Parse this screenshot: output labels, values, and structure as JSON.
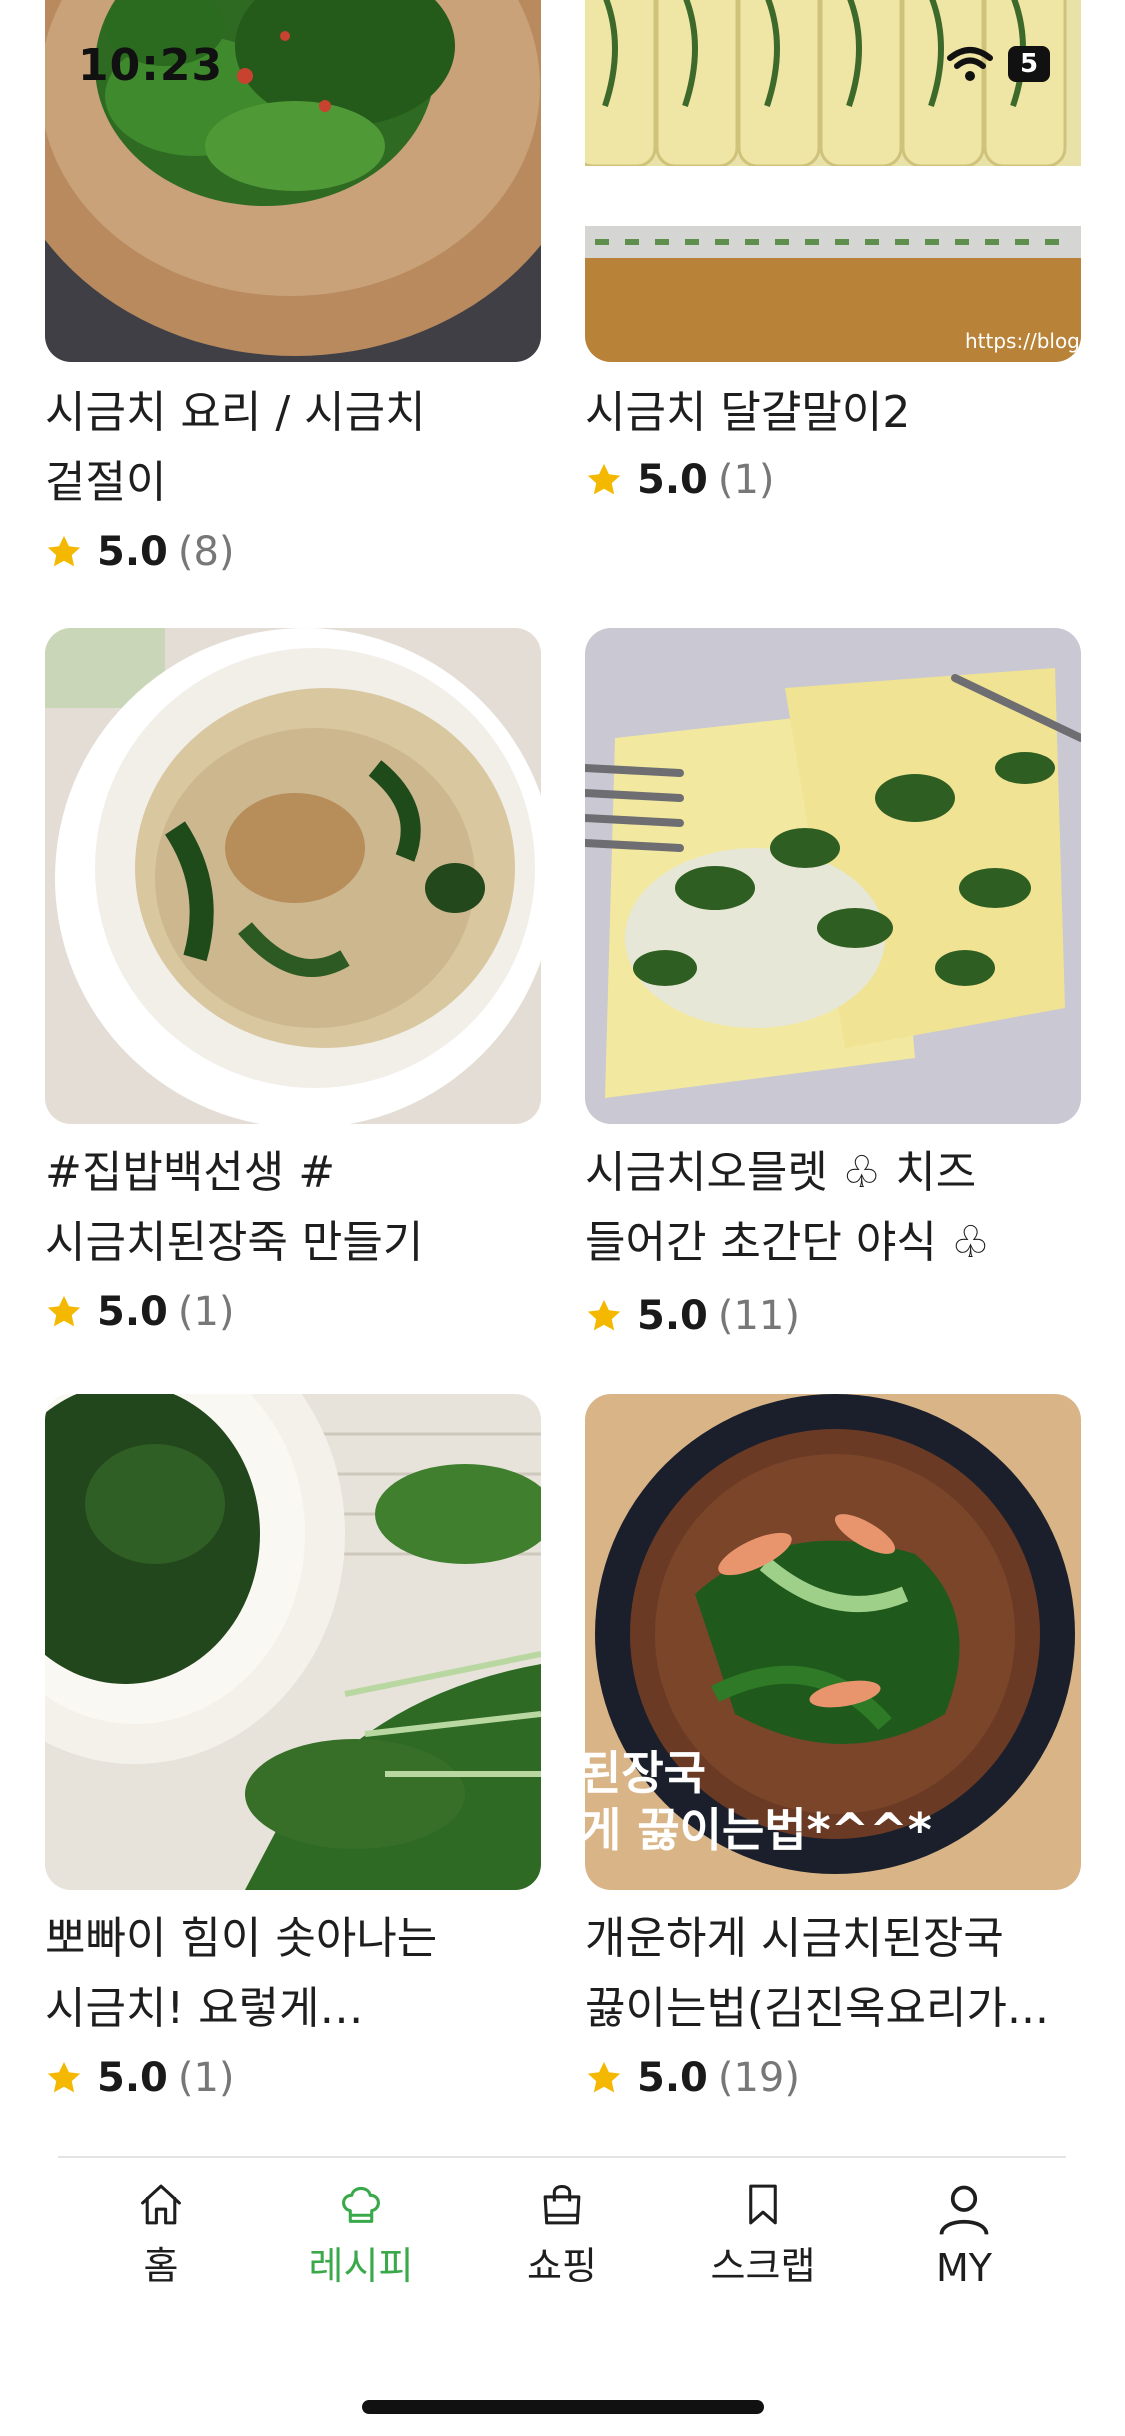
{
  "status_bar": {
    "time": "10:23",
    "battery": "5"
  },
  "recipes": [
    {
      "title": "시금치 요리 / 시금치 겉절이",
      "score": "5.0",
      "count": "(8)"
    },
    {
      "title": "시금치 달걀말이2",
      "score": "5.0",
      "count": "(1)"
    },
    {
      "title": "#집밥백선생 #시금치된장죽 만들기",
      "score": "5.0",
      "count": "(1)"
    },
    {
      "title": "시금치오믈렛 ♧ 치즈 들어간 초간단 야식 ♧",
      "score": "5.0",
      "count": "(11)"
    },
    {
      "title": "뽀빠이 힘이 솟아나는 시금치! 요렇게 손질해요!...",
      "score": "5.0",
      "count": "(1)"
    },
    {
      "title": "개운하게 시금치된장국 끓이는법(김진옥요리가...",
      "score": "5.0",
      "count": "(19)"
    }
  ],
  "thumb_texts": {
    "watermark": "https://blog",
    "overlay_line1": "된장국",
    "overlay_line2": "게 끓이는법*^^*"
  },
  "tabs": [
    {
      "label": "홈",
      "icon": "home-icon"
    },
    {
      "label": "레시피",
      "icon": "chef-hat-icon"
    },
    {
      "label": "쇼핑",
      "icon": "shopping-bag-icon"
    },
    {
      "label": "스크랩",
      "icon": "bookmark-icon"
    },
    {
      "label": "MY",
      "icon": "person-icon"
    }
  ],
  "colors": {
    "active_tab": "#3aa94a",
    "star": "#f5b800"
  }
}
